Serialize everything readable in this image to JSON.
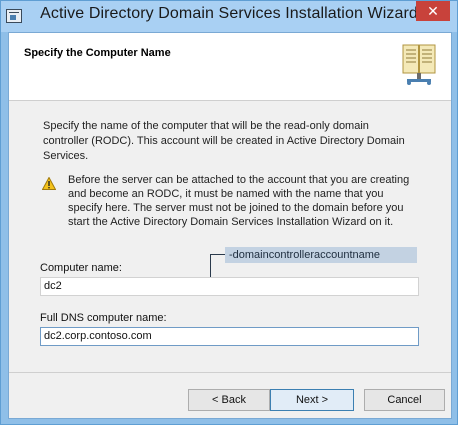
{
  "window": {
    "title": "Active Directory Domain Services Installation Wizard",
    "close_glyph": "✕"
  },
  "header": {
    "title": "Specify the Computer Name"
  },
  "body": {
    "description": "Specify the name of the computer that will be the read-only domain controller (RODC). This account will be created in Active Directory Domain Services.",
    "warning": "Before the server can be attached to the account that you are creating and become an RODC, it must be named with the name that you specify here. The server must not be joined to the domain before you start the Active Directory Domain Services Installation Wizard on it."
  },
  "callout": {
    "text": "-domaincontrolleraccountname"
  },
  "fields": {
    "computer_name_label": "Computer name:",
    "computer_name_value": "dc2",
    "dns_name_label": "Full DNS computer name:",
    "dns_name_value": "dc2.corp.contoso.com"
  },
  "buttons": {
    "back": "< Back",
    "next": "Next >",
    "cancel": "Cancel"
  },
  "colors": {
    "titlebar": "#a9d0f3",
    "close_button": "#c8423b",
    "callout_bg": "#c3d2e2"
  },
  "icons": {
    "window_icon": "wizard-window-icon",
    "header_icon": "book-icon",
    "warning_icon": "warning-icon"
  }
}
